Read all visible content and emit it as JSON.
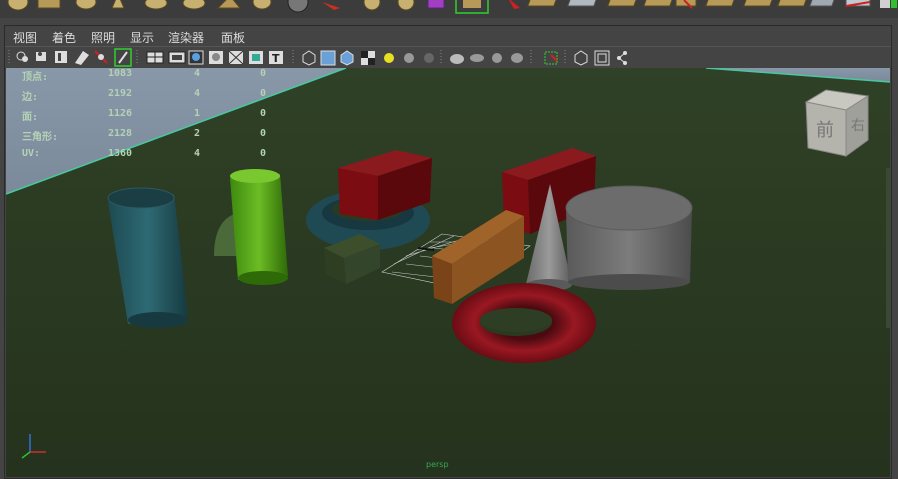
{
  "menu": {
    "items": [
      "视图",
      "着色",
      "照明",
      "显示",
      "渲染器",
      "面板"
    ]
  },
  "hud": {
    "rows": [
      {
        "label": "顶点:",
        "c1": "1083",
        "c2": "4",
        "c3": "0"
      },
      {
        "label": "边:",
        "c1": "2192",
        "c2": "4",
        "c3": "0"
      },
      {
        "label": "面:",
        "c1": "1126",
        "c2": "1",
        "c3": "0"
      },
      {
        "label": "三角形:",
        "c1": "2128",
        "c2": "2",
        "c3": "0"
      },
      {
        "label": "UV:",
        "c1": "1360",
        "c2": "4",
        "c3": "0"
      }
    ]
  },
  "viewcube": {
    "front_label": "前",
    "right_label": "右"
  },
  "footer": {
    "camera_label": "persp"
  },
  "colors": {
    "ground": "#2d3e22",
    "sky": "#8898a8",
    "grid_line": "#47c9a0",
    "hud_text": "#b4d2b4"
  }
}
